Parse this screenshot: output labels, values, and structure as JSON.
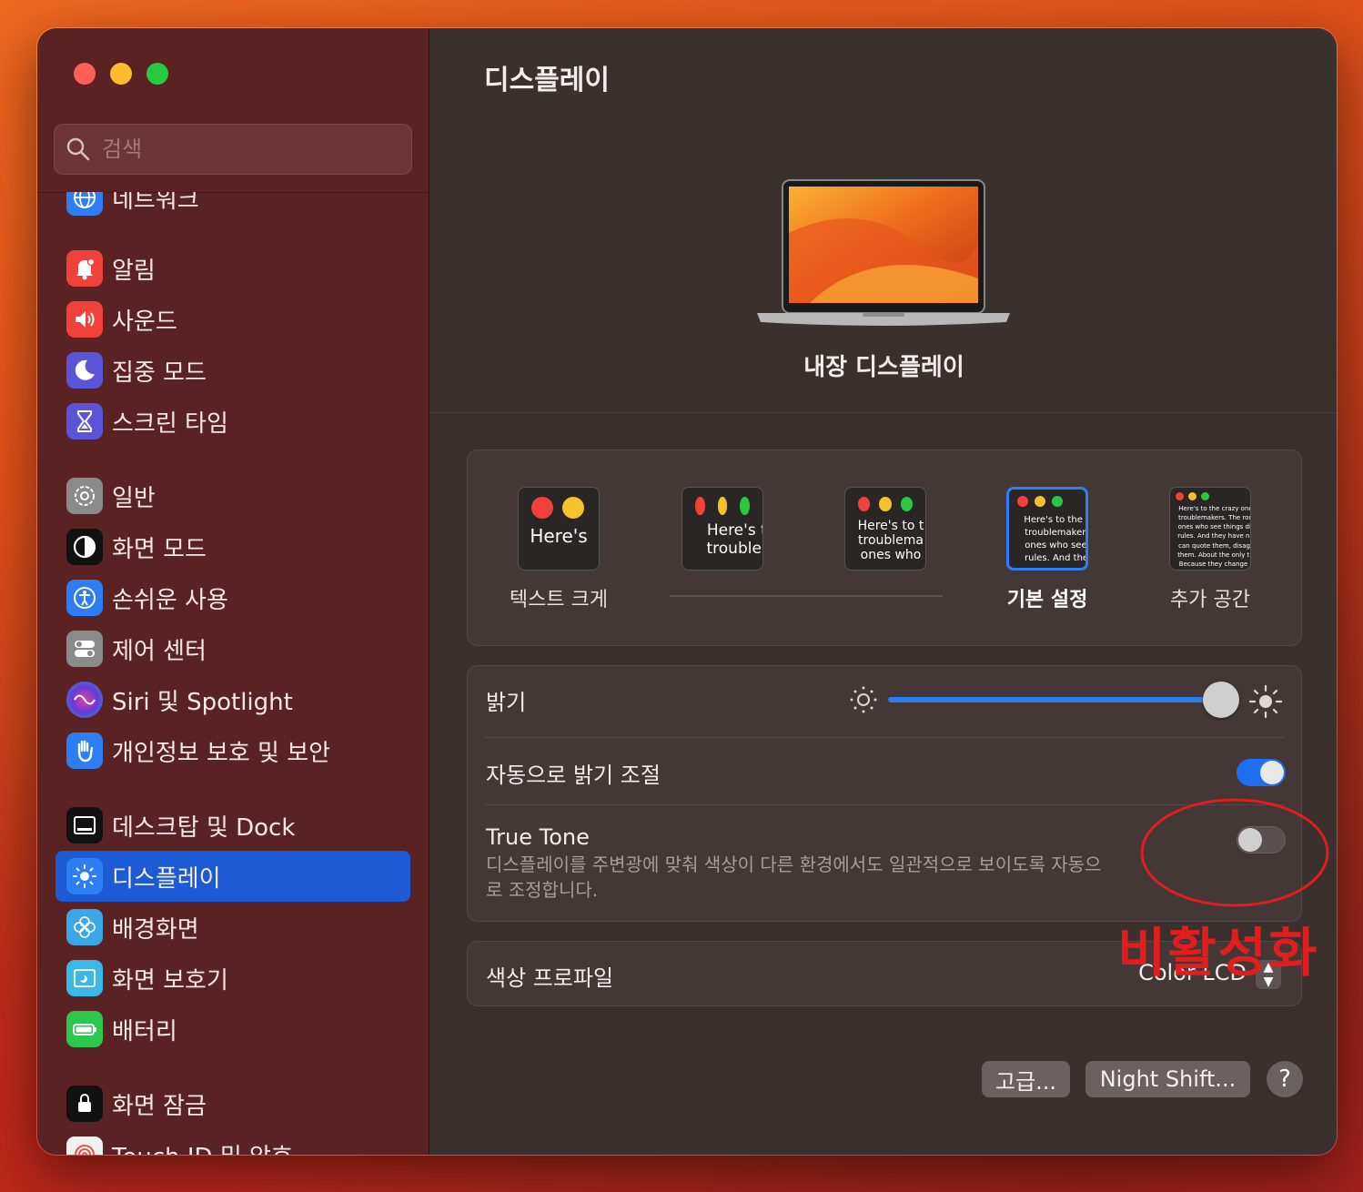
{
  "sidebar": {
    "search_placeholder": "검색",
    "items": [
      {
        "label": "네트워크",
        "icon": "globe-icon",
        "color": "#2d7ef5"
      },
      {
        "label": "알림",
        "icon": "bell-icon",
        "color": "#f0413a"
      },
      {
        "label": "사운드",
        "icon": "speaker-icon",
        "color": "#f0413a"
      },
      {
        "label": "집중 모드",
        "icon": "moon-icon",
        "color": "#5a55d8"
      },
      {
        "label": "스크린 타임",
        "icon": "hourglass-icon",
        "color": "#5a55d8"
      },
      {
        "label": "일반",
        "icon": "gear-icon",
        "color": "#8a8a8a"
      },
      {
        "label": "화면 모드",
        "icon": "appearance-icon",
        "color": "#111111"
      },
      {
        "label": "손쉬운 사용",
        "icon": "accessibility-icon",
        "color": "#2d7ef5"
      },
      {
        "label": "제어 센터",
        "icon": "toggles-icon",
        "color": "#8a8a8a"
      },
      {
        "label": "Siri 및 Spotlight",
        "icon": "siri-icon",
        "color": "#7a3ac8"
      },
      {
        "label": "개인정보 보호 및 보안",
        "icon": "hand-icon",
        "color": "#2d7ef5"
      },
      {
        "label": "데스크탑 및 Dock",
        "icon": "dock-icon",
        "color": "#111111"
      },
      {
        "label": "디스플레이",
        "icon": "sun-icon",
        "color": "#2d7ef5"
      },
      {
        "label": "배경화면",
        "icon": "flower-icon",
        "color": "#3aa8e8"
      },
      {
        "label": "화면 보호기",
        "icon": "screensaver-icon",
        "color": "#3ab8e8"
      },
      {
        "label": "배터리",
        "icon": "battery-icon",
        "color": "#2cc84e"
      },
      {
        "label": "화면 잠금",
        "icon": "lock-icon",
        "color": "#111111"
      },
      {
        "label": "Touch ID 및 암호",
        "icon": "fingerprint-icon",
        "color": "#f0f0f0"
      }
    ]
  },
  "main": {
    "title": "디스플레이",
    "display_name": "내장 디스플레이",
    "resolution_options": [
      {
        "label": "텍스트 크게",
        "preview": "Here's"
      },
      {
        "label": "",
        "preview": "Here's to troublem"
      },
      {
        "label": "",
        "preview": "Here's to t troublema ones who"
      },
      {
        "label": "기본 설정",
        "preview": "Here's to the cr troublemakers. ones who see t rules. And they"
      },
      {
        "label": "추가 공간",
        "preview": "Here's to the crazy one troublemakers. The rou ones who see things dif rules. And they have no can quote them, disagr them. About the only th Because they change t"
      }
    ],
    "selected_resolution": "기본 설정",
    "brightness_label": "밝기",
    "brightness_level": 0.95,
    "auto_brightness_label": "자동으로 밝기 조절",
    "auto_brightness_on": true,
    "true_tone_label": "True Tone",
    "true_tone_desc": "디스플레이를 주변광에 맞춰 색상이 다른 환경에서도 일관적으로 보이도록 자동으로 조정합니다.",
    "true_tone_on": false,
    "color_profile_label": "색상 프로파일",
    "color_profile_value": "Color LCD",
    "advanced_button": "고급...",
    "night_shift_button": "Night Shift...",
    "help_button": "?"
  },
  "annotation": {
    "text": "비활성화",
    "color": "#e11d1d"
  }
}
